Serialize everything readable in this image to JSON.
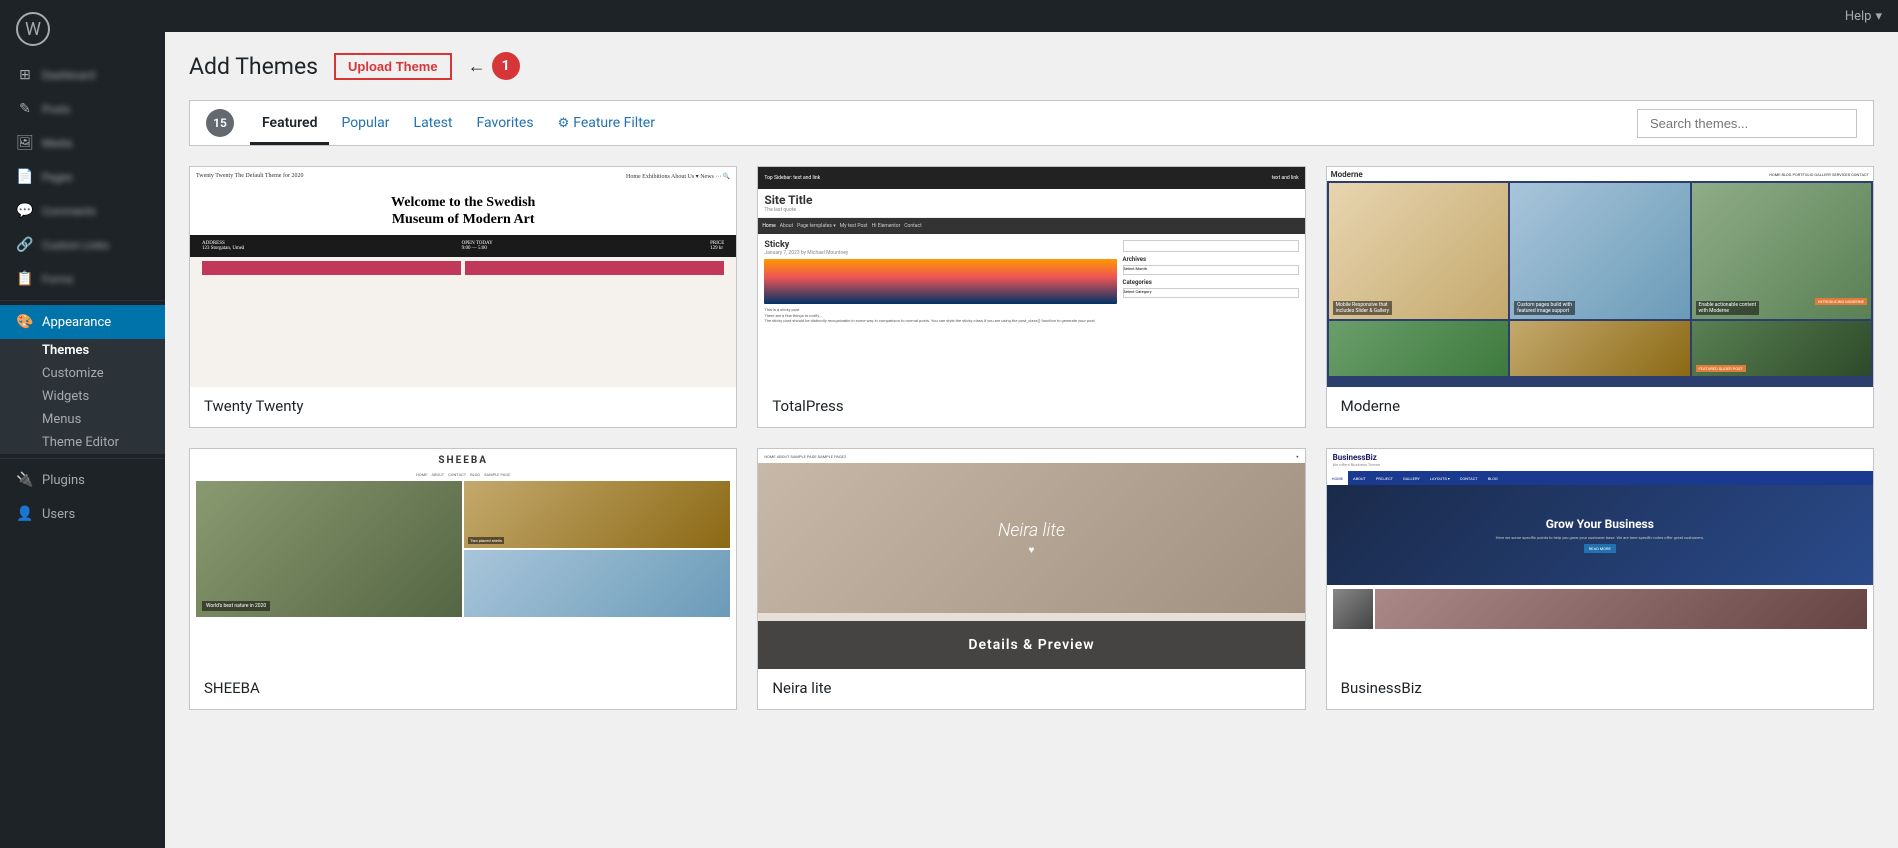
{
  "topbar": {
    "help_label": "Help"
  },
  "sidebar": {
    "items": [
      {
        "id": "dashboard",
        "label": "Dashboard",
        "icon": "⊞"
      },
      {
        "id": "posts",
        "label": "Posts",
        "icon": "✎"
      },
      {
        "id": "media",
        "label": "Media",
        "icon": "🖼"
      },
      {
        "id": "pages",
        "label": "Pages",
        "icon": "📄"
      },
      {
        "id": "comments",
        "label": "Comments",
        "icon": "💬"
      },
      {
        "id": "customlinks",
        "label": "Custom Links",
        "icon": "🔗"
      },
      {
        "id": "forms",
        "label": "Forms",
        "icon": "📋"
      }
    ],
    "appearance": {
      "label": "Appearance",
      "icon": "🎨",
      "sub_items": [
        {
          "id": "themes",
          "label": "Themes",
          "active": true
        },
        {
          "id": "customize",
          "label": "Customize"
        },
        {
          "id": "widgets",
          "label": "Widgets"
        },
        {
          "id": "menus",
          "label": "Menus"
        },
        {
          "id": "theme-editor",
          "label": "Theme Editor"
        }
      ]
    },
    "plugins": {
      "label": "Plugins",
      "icon": "🔌"
    },
    "users": {
      "label": "Users",
      "icon": "👤"
    }
  },
  "header": {
    "title": "Add Themes",
    "upload_btn": "Upload Theme",
    "badge_number": "1",
    "help_label": "Help"
  },
  "tabs": {
    "count": "15",
    "items": [
      {
        "id": "featured",
        "label": "Featured",
        "active": true
      },
      {
        "id": "popular",
        "label": "Popular"
      },
      {
        "id": "latest",
        "label": "Latest"
      },
      {
        "id": "favorites",
        "label": "Favorites"
      },
      {
        "id": "feature-filter",
        "label": "Feature Filter",
        "has_icon": true
      }
    ],
    "search_placeholder": "Search themes..."
  },
  "themes": [
    {
      "id": "twenty-twenty",
      "name": "Twenty Twenty",
      "row": 1
    },
    {
      "id": "totalpress",
      "name": "TotalPress",
      "row": 1
    },
    {
      "id": "moderne",
      "name": "Moderne",
      "row": 1
    },
    {
      "id": "sheeba",
      "name": "SHEEBA",
      "row": 2
    },
    {
      "id": "neira-lite",
      "name": "Neira lite",
      "row": 2,
      "has_overlay": true,
      "overlay_text": "Details & Preview"
    },
    {
      "id": "businessbiz",
      "name": "BusinessBiz",
      "row": 2
    }
  ]
}
